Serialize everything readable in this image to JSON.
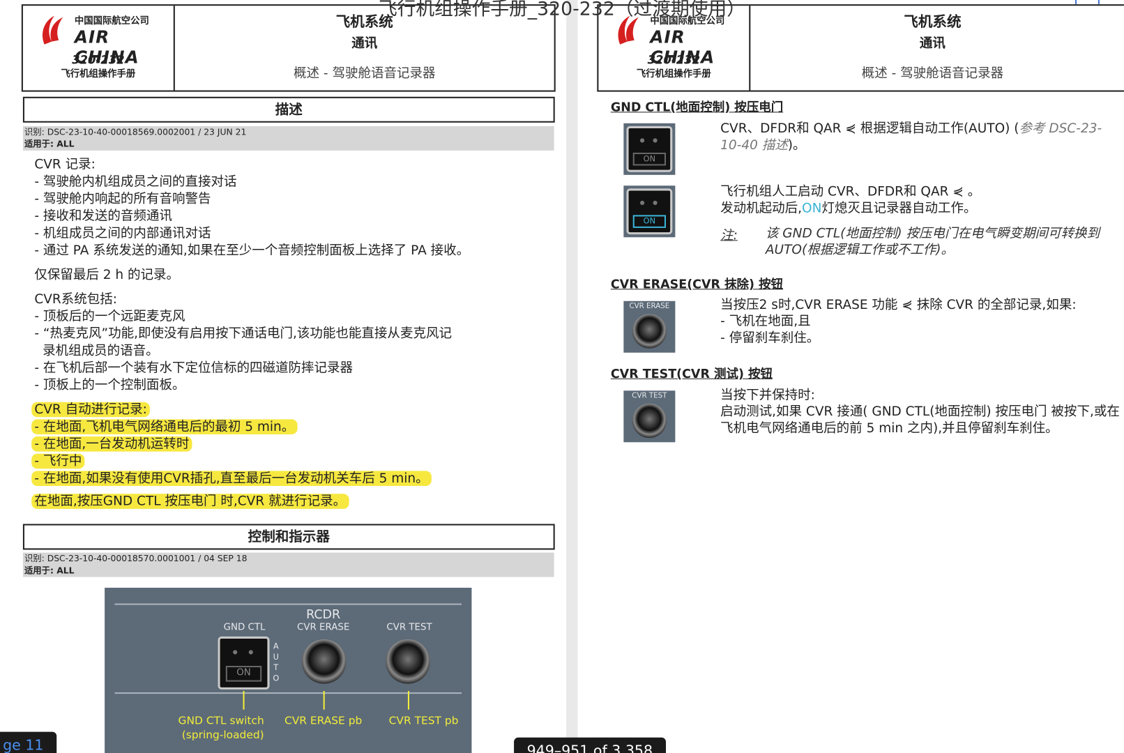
{
  "window": {
    "title_overlay": "飞行机组操作手册_320-232（过渡期使用）",
    "page_indicator": "ge 11",
    "range": "949–951 of 3,358"
  },
  "header": {
    "airline_cn": "中国国际航空公司",
    "airline_en": "AIR CHINA",
    "model": "320-232",
    "manual": "飞行机组操作手册",
    "chapter": "飞机系统",
    "section": "通讯",
    "topic": "概述 - 驾驶舱语音记录器"
  },
  "left": {
    "desc_title": "描述",
    "ident1": "识别: DSC-23-10-40-00018569.0002001 / 23 JUN 21",
    "applies1": "适用于: ALL",
    "cvr_rec": "CVR 记录:",
    "rec_items": [
      "- 驾驶舱内机组成员之间的直接对话",
      "- 驾驶舱内响起的所有音响警告",
      "- 接收和发送的音频通讯",
      "- 机组成员之间的内部通讯对话",
      "- 通过 PA 系统发送的通知,如果在至少一个音频控制面板上选择了 PA 接收。"
    ],
    "keep": "仅保留最后 2 h 的记录。",
    "sys_title": "CVR系统包括:",
    "sys_items": [
      "- 顶板后的一个远距麦克风",
      "- “热麦克风”功能,即使没有启用按下通话电门,该功能也能直接从麦克风记",
      "  录机组成员的语音。",
      "- 在飞机后部一个装有水下定位信标的四磁道防摔记录器",
      "- 顶板上的一个控制面板。"
    ],
    "auto_title": "CVR 自动进行记录:",
    "auto_items": [
      "- 在地面,飞机电气网络通电后的最初 5 min。",
      "- 在地面,一台发动机运转时",
      "- 飞行中",
      "- 在地面,如果没有使用CVR插孔,直至最后一台发动机关车后 5 min。"
    ],
    "gnd_note": "在地面,按压GND CTL 按压电门 时,CVR 就进行记录。",
    "ctrl_title": "控制和指示器",
    "ident2": "识别: DSC-23-10-40-00018570.0001001 / 04 SEP 18",
    "applies2": "适用于: ALL",
    "panel": {
      "rcdr": "RCDR",
      "gnd_ctl": "GND CTL",
      "cvr_erase": "CVR ERASE",
      "cvr_test": "CVR TEST",
      "on": "ON",
      "auto": "AUTO",
      "lbl_gnd": "GND CTL switch",
      "lbl_gnd2": "(spring-loaded)",
      "lbl_erase": "CVR ERASE pb",
      "lbl_test": "CVR TEST pb"
    }
  },
  "right": {
    "gnd_title": "GND CTL(地面控制) 按压电门",
    "gnd_p1": "CVR、DFDR和 QAR ⋞ 根据逻辑自动工作(AUTO) (",
    "gnd_p1_ref": "参考 DSC-23-10-40 描述",
    "gnd_p1_end": ")。",
    "gnd_p2": "飞行机组人工启动 CVR、DFDR和 QAR ⋞ 。",
    "gnd_p3a": "发动机起动后,",
    "gnd_p3_on": "ON",
    "gnd_p3b": "灯熄灭且记录器自动工作。",
    "note_label": "注:",
    "note_text": "该 GND CTL(地面控制) 按压电门在电气瞬变期间可转换到 AUTO(根据逻辑工作或不工作)。",
    "erase_title": "CVR ERASE(CVR 抹除) 按钮",
    "erase_p": [
      "当按压2 s时,CVR ERASE 功能 ⋞ 抹除 CVR 的全部记录,如果:",
      "- 飞机在地面,且",
      "- 停留刹车刹住。"
    ],
    "test_title": "CVR TEST(CVR 测试) 按钮",
    "test_p": [
      "当按下并保持时:",
      "启动测试,如果 CVR 接通( GND CTL(地面控制) 按压电门 被按下,或在飞机电气网络通电后的前 5 min 之内),并且停留刹车刹住。"
    ],
    "icon_erase": "CVR ERASE",
    "icon_test": "CVR TEST",
    "on": "ON"
  },
  "colors": {
    "highlight": "#f7e840",
    "on_cyan": "#3ab3d6",
    "panel": "#5d6a78"
  }
}
